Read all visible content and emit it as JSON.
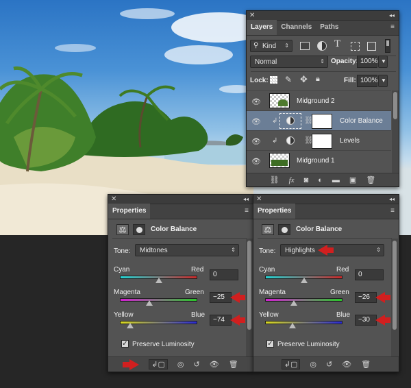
{
  "layers_panel": {
    "tabs": [
      {
        "label": "Layers"
      },
      {
        "label": "Channels"
      },
      {
        "label": "Paths"
      }
    ],
    "kind_label": "Kind",
    "blend_mode": "Normal",
    "opacity_label": "Opacity:",
    "opacity_value": "100%",
    "lock_label": "Lock:",
    "fill_label": "Fill:",
    "fill_value": "100%",
    "layers": [
      {
        "name": "Midground 2"
      },
      {
        "name": "Color Balance"
      },
      {
        "name": "Levels"
      },
      {
        "name": "Midground 1"
      }
    ]
  },
  "properties_left": {
    "tab": "Properties",
    "title": "Color Balance",
    "tone_label": "Tone:",
    "tone_value": "Midtones",
    "cyan": "Cyan",
    "red": "Red",
    "cr_value": "0",
    "magenta": "Magenta",
    "green": "Green",
    "mg_value": "−25",
    "yellow": "Yellow",
    "blue": "Blue",
    "yb_value": "−74",
    "preserve": "Preserve Luminosity",
    "levels": {
      "cr": 0,
      "mg": -25,
      "yb": -74
    }
  },
  "properties_right": {
    "tab": "Properties",
    "title": "Color Balance",
    "tone_label": "Tone:",
    "tone_value": "Highlights",
    "cyan": "Cyan",
    "red": "Red",
    "cr_value": "0",
    "magenta": "Magenta",
    "green": "Green",
    "mg_value": "−26",
    "yellow": "Yellow",
    "blue": "Blue",
    "yb_value": "−30",
    "preserve": "Preserve Luminosity",
    "levels": {
      "cr": 0,
      "mg": -26,
      "yb": -30
    }
  },
  "colors": {
    "accent_arrow": "#d11f1f",
    "selected_layer": "#6b7e96"
  }
}
